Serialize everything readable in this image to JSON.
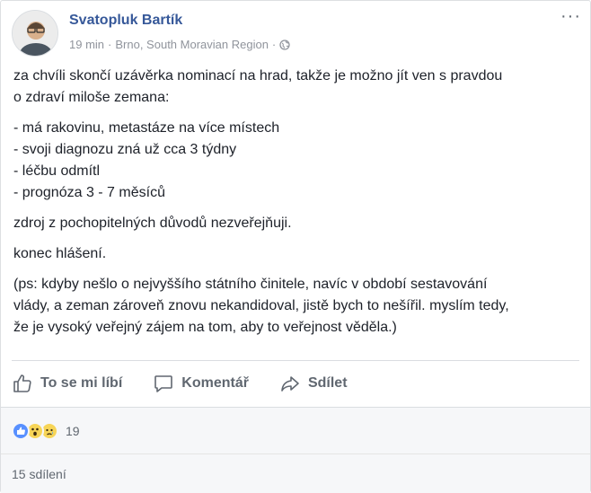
{
  "post": {
    "author": "Svatopluk Bartík",
    "time": "19 min",
    "location": "Brno, South Moravian Region",
    "separator": "·",
    "more": "···",
    "paragraphs": {
      "p1a": "za chvíli skončí uzávěrka nominací na hrad, takže je možno jít ven s pravdou",
      "p1b": "o zdraví miloše zemana:",
      "list": [
        "- má rakovinu, metastáze na více místech",
        "- svoji diagnozu zná už cca 3 týdny",
        "- léčbu odmítl",
        "- prognóza 3 - 7 měsíců"
      ],
      "p2": "zdroj z pochopitelných důvodů nezveřejňuji.",
      "p3": "konec hlášení.",
      "p4a": "(ps: kdyby nešlo o nejvyššího státního činitele, navíc v období sestavování",
      "p4b": "vlády, a zeman zároveň znovu nekandidoval, jistě bych to nešířil. myslím tedy,",
      "p4c": "že je vysoký veřejný zájem na tom, aby to veřejnost věděla.)"
    }
  },
  "actions": {
    "like": "To se mi líbí",
    "comment": "Komentář",
    "share": "Sdílet"
  },
  "reactions": {
    "icons": [
      "like-reaction-icon",
      "wow-reaction-icon",
      "sad-reaction-icon"
    ],
    "count": "19"
  },
  "shares": "15 sdílení",
  "colors": {
    "author": "#365899",
    "meta": "#90949c",
    "action": "#606770",
    "like_blue": "#5890ff",
    "emoji_yellow": "#f7d558"
  }
}
